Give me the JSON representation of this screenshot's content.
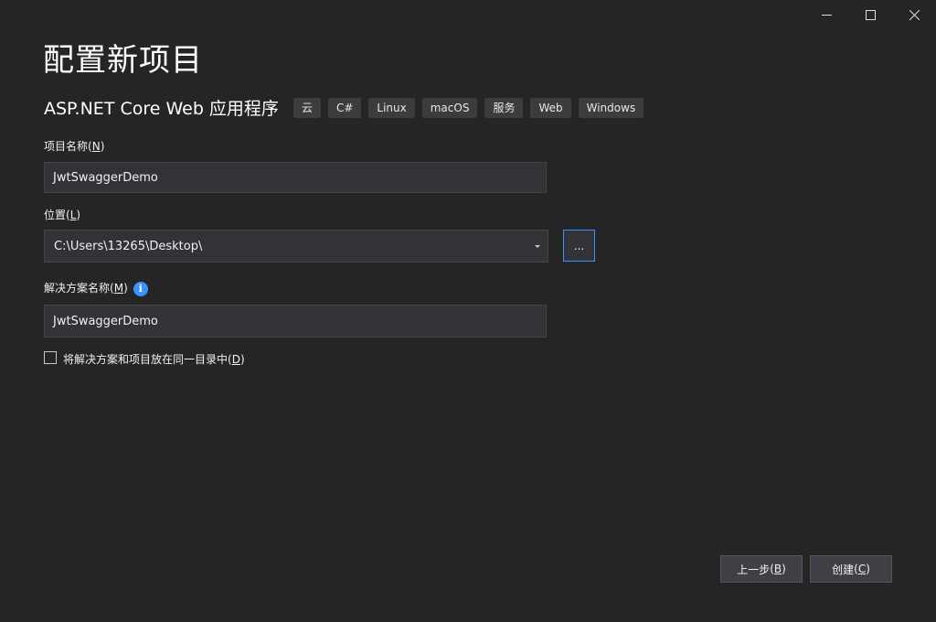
{
  "window": {
    "controls": [
      "minimize-icon",
      "maximize-icon",
      "close-icon"
    ]
  },
  "page": {
    "title": "配置新项目"
  },
  "template": {
    "name": "ASP.NET Core Web 应用程序",
    "tags": [
      "云",
      "C#",
      "Linux",
      "macOS",
      "服务",
      "Web",
      "Windows"
    ]
  },
  "project_name": {
    "label": "项目名称",
    "accesskey": "N",
    "value": "JwtSwaggerDemo"
  },
  "location": {
    "label": "位置",
    "accesskey": "L",
    "value": "C:\\Users\\13265\\Desktop\\",
    "browse_label": "..."
  },
  "solution_name": {
    "label": "解决方案名称",
    "accesskey": "M",
    "value": "JwtSwaggerDemo",
    "info_icon": "i"
  },
  "same_dir": {
    "label": "将解决方案和项目放在同一目录中",
    "accesskey": "D",
    "checked": false
  },
  "footer": {
    "back_label": "上一步",
    "back_accesskey": "B",
    "create_label": "创建",
    "create_accesskey": "C"
  },
  "colors": {
    "background": "#252526",
    "accent": "#3794ff",
    "field_bg": "#333337"
  }
}
